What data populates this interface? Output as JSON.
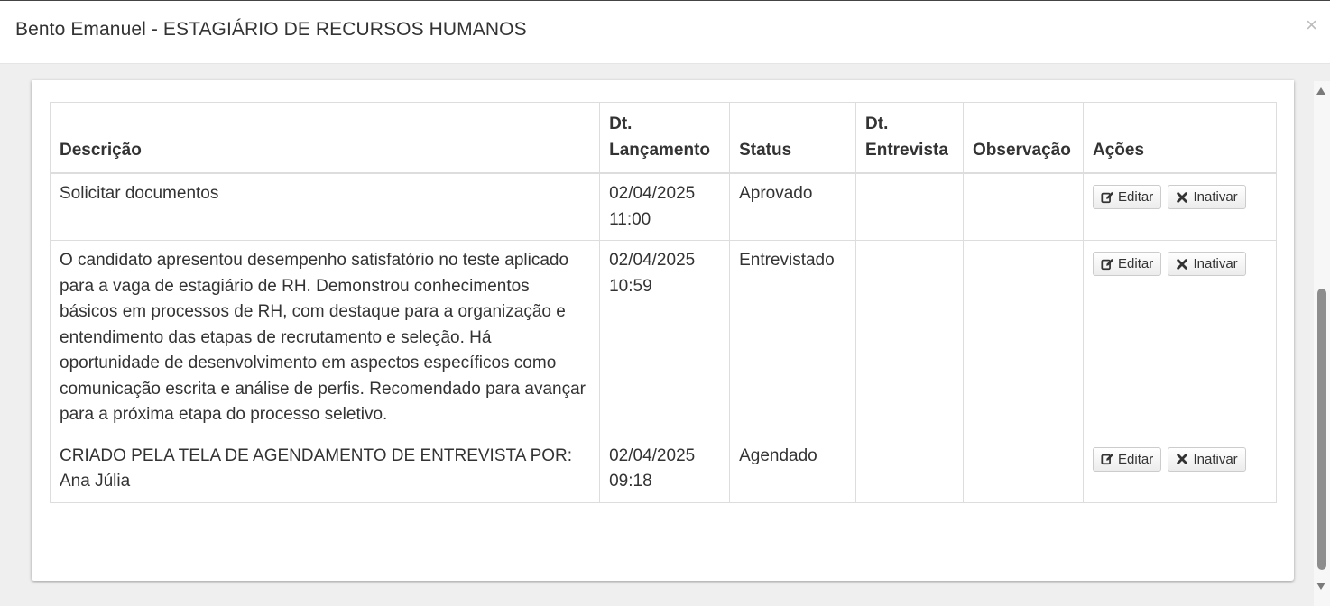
{
  "modal": {
    "title": "Bento Emanuel - ESTAGIÁRIO DE RECURSOS HUMANOS",
    "close": "×"
  },
  "table": {
    "headers": {
      "descricao": "Descrição",
      "dt_lancamento_1": "Dt.",
      "dt_lancamento_2": "Lançamento",
      "status": "Status",
      "dt_entrevista_1": "Dt.",
      "dt_entrevista_2": "Entrevista",
      "observacao": "Observação",
      "acoes": "Ações"
    },
    "rows": [
      {
        "descricao": "Solicitar documentos",
        "data": "02/04/2025",
        "hora": "11:00",
        "status": "Aprovado",
        "dt_entrevista": "",
        "observacao": ""
      },
      {
        "descricao": "O candidato apresentou desempenho satisfatório no teste aplicado para a vaga de estagiário de RH. Demonstrou conhecimentos básicos em processos de RH, com destaque para a organização e entendimento das etapas de recrutamento e seleção. Há oportunidade de desenvolvimento em aspectos específicos como comunicação escrita e análise de perfis. Recomendado para avançar para a próxima etapa do processo seletivo.",
        "data": "02/04/2025",
        "hora": "10:59",
        "status": "Entrevistado",
        "dt_entrevista": "",
        "observacao": ""
      },
      {
        "descricao": "CRIADO PELA TELA DE AGENDAMENTO DE ENTREVISTA POR: Ana Júlia",
        "data": "02/04/2025",
        "hora": "09:18",
        "status": "Agendado",
        "dt_entrevista": "",
        "observacao": ""
      }
    ]
  },
  "actions": {
    "edit_label": "Editar",
    "inactivate_label": "Inativar",
    "edit_icon": "edit-icon",
    "inactivate_icon": "times-icon"
  }
}
